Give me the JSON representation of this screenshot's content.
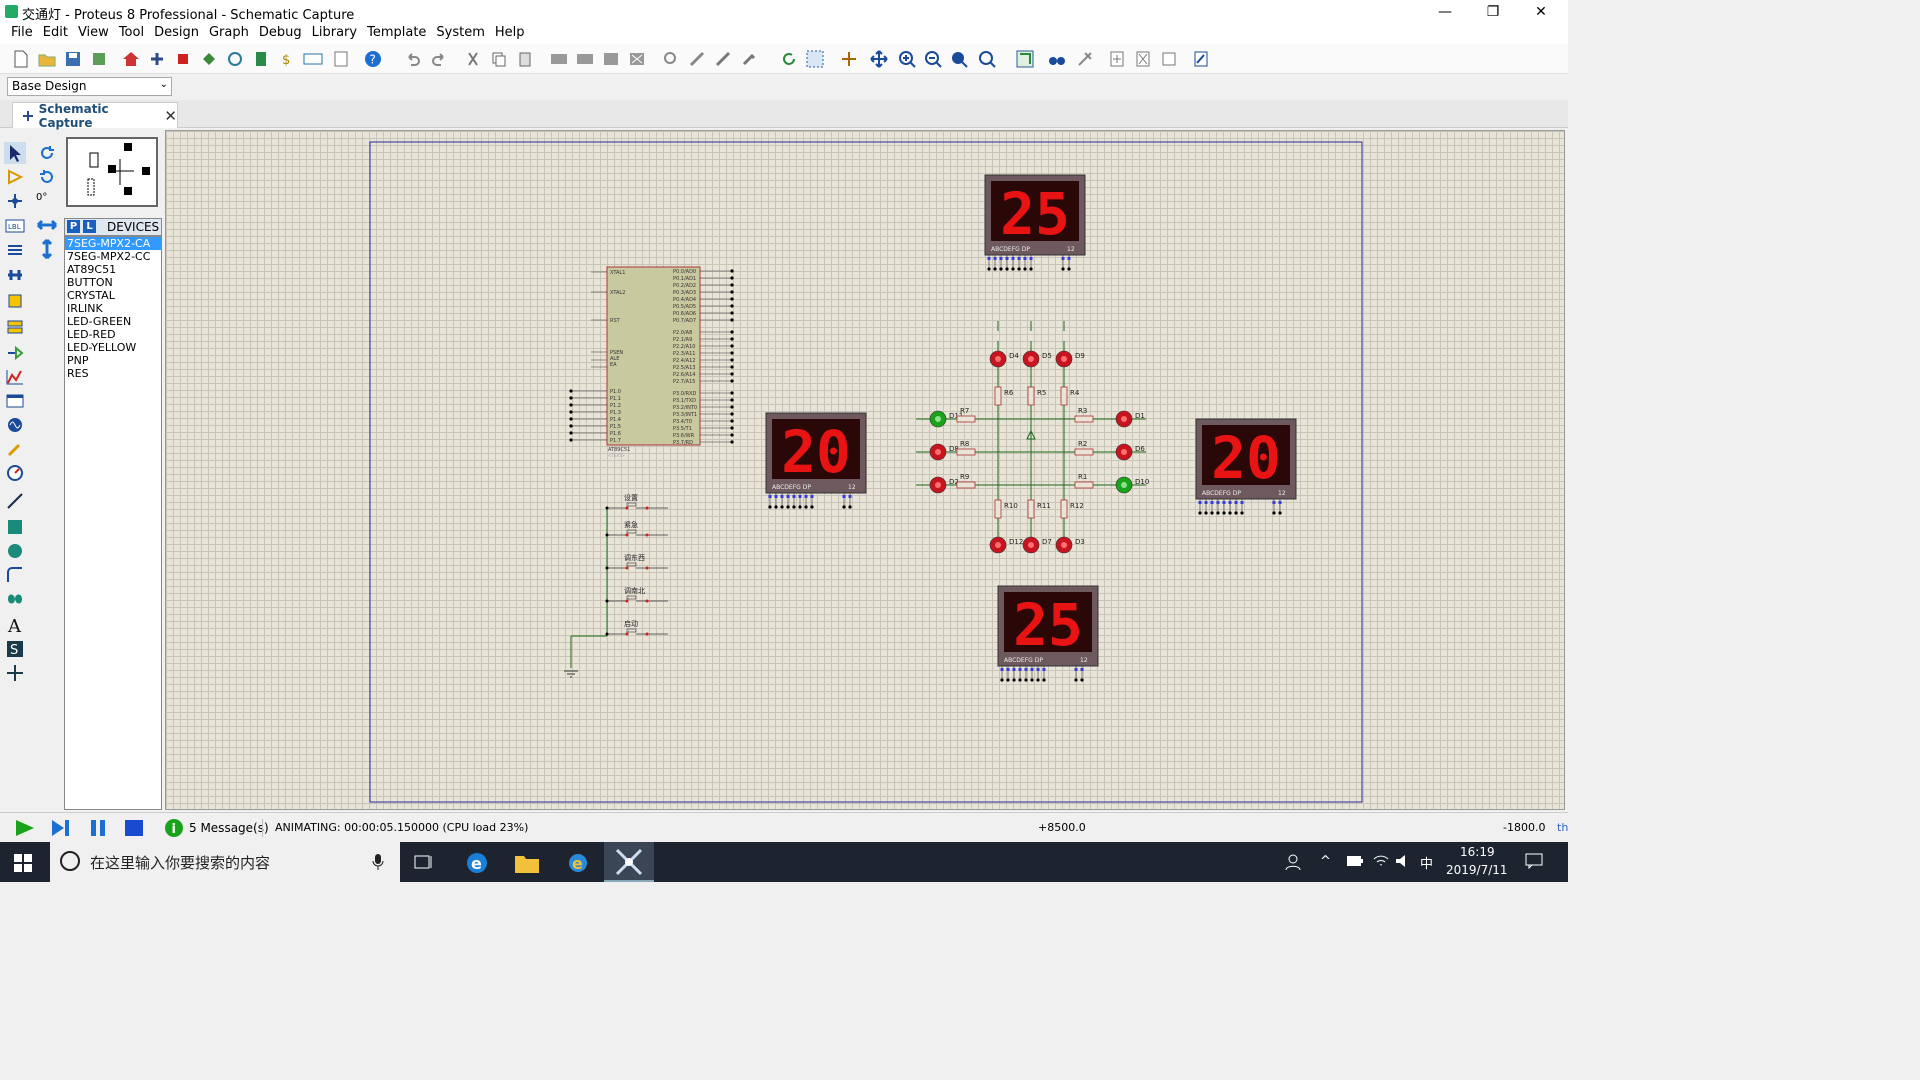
{
  "window": {
    "title": "交通灯 - Proteus 8 Professional - Schematic Capture",
    "minimize": "—",
    "maximize": "❐",
    "close": "✕"
  },
  "menu": [
    "File",
    "Edit",
    "View",
    "Tool",
    "Design",
    "Graph",
    "Debug",
    "Library",
    "Template",
    "System",
    "Help"
  ],
  "design_select": "Base Design",
  "tab": {
    "label": "Schematic Capture",
    "close": "✕"
  },
  "rotation": "0°",
  "devices": {
    "header": "DEVICES",
    "p": "P",
    "l": "L",
    "items": [
      "7SEG-MPX2-CA",
      "7SEG-MPX2-CC",
      "AT89C51",
      "BUTTON",
      "CRYSTAL",
      "IRLINK",
      "LED-GREEN",
      "LED-RED",
      "LED-YELLOW",
      "PNP",
      "RES"
    ],
    "selected": 0
  },
  "schematic": {
    "displays": [
      {
        "name": "top",
        "value": "25",
        "label": "ABCDEFG DP",
        "pins": "12"
      },
      {
        "name": "left",
        "value": "20",
        "label": "ABCDEFG DP",
        "pins": "12"
      },
      {
        "name": "right",
        "value": "20",
        "label": "ABCDEFG DP",
        "pins": "12"
      },
      {
        "name": "bottom",
        "value": "25",
        "label": "ABCDEFG DP",
        "pins": "12"
      }
    ],
    "mcu": {
      "name": "AT89C51",
      "text": "<TEXT>",
      "left_pins": [
        "XTAL1",
        "XTAL2",
        "RST",
        "PSEN",
        "ALE",
        "EA",
        "P1.0",
        "P1.1",
        "P1.2",
        "P1.3",
        "P1.4",
        "P1.5",
        "P1.6",
        "P1.7"
      ],
      "right_pins": [
        "P0.0/AD0",
        "P0.1/AD1",
        "P0.2/AD2",
        "P0.3/AD3",
        "P0.4/AD4",
        "P0.5/AD5",
        "P0.6/AD6",
        "P0.7/AD7",
        "P2.0/A8",
        "P2.1/A9",
        "P2.2/A10",
        "P2.3/A11",
        "P2.4/A12",
        "P2.5/A13",
        "P2.6/A14",
        "P2.7/A15",
        "P3.0/RXD",
        "P3.1/TXD",
        "P3.2/INT0",
        "P3.3/INT1",
        "P3.4/T0",
        "P3.5/T1",
        "P3.6/WR",
        "P3.7/RD"
      ]
    },
    "buttons": [
      "设置",
      "紧急",
      "调东西",
      "调南北",
      "启动"
    ],
    "leds": [
      {
        "id": "D4",
        "color": "red"
      },
      {
        "id": "D5",
        "color": "red"
      },
      {
        "id": "D9",
        "color": "red"
      },
      {
        "id": "D11",
        "color": "green"
      },
      {
        "id": "D8",
        "color": "red"
      },
      {
        "id": "D2",
        "color": "red"
      },
      {
        "id": "D1",
        "color": "red"
      },
      {
        "id": "D6",
        "color": "red"
      },
      {
        "id": "D10",
        "color": "green"
      },
      {
        "id": "D12",
        "color": "red"
      },
      {
        "id": "D7",
        "color": "red"
      },
      {
        "id": "D3",
        "color": "red"
      }
    ],
    "resistors": [
      "R6",
      "R5",
      "R4",
      "R7",
      "R3",
      "R8",
      "R2",
      "R9",
      "R1",
      "R10",
      "R11",
      "R12"
    ]
  },
  "status": {
    "messages": "5 Message(s)",
    "anim": "ANIMATING: 00:00:05.150000 (CPU load 23%)",
    "x": "+8500.0",
    "y": "-1800.0",
    "unit": "th"
  },
  "taskbar": {
    "search": "在这里输入你要搜索的内容",
    "time": "16:19",
    "date": "2019/7/11",
    "ime": "中"
  }
}
